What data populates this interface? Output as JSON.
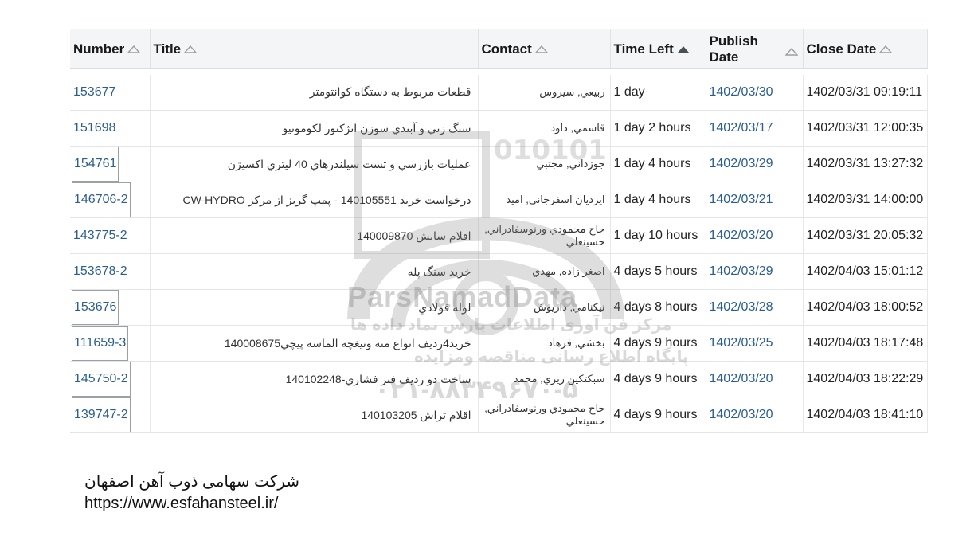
{
  "grid": {
    "columns": {
      "number": "Number",
      "title": "Title",
      "contact": "Contact",
      "time_left": "Time Left",
      "publish_line1": "Publish",
      "publish_line2": "Date",
      "close_date": "Close Date"
    },
    "rows": [
      {
        "number": "153677",
        "title": "قطعات مربوط به دستگاه کوانتومتر",
        "contact": "ربيعي, سيروس",
        "time_left": "1 day",
        "publish": "1402/03/30",
        "close": "1402/03/31 09:19:11"
      },
      {
        "number": "151698",
        "title": "سنگ زني و آبندي سوزن انژکتور لکوموتيو",
        "contact": "قاسمي, داود",
        "time_left": "1 day 2 hours",
        "publish": "1402/03/17",
        "close": "1402/03/31 12:00:35"
      },
      {
        "number": "154761",
        "title": "عمليات بازرسي و تست سيلندرهاي 40 ليتري اکسيژن",
        "contact": "جوزداني, مجتبي",
        "time_left": "1 day 4 hours",
        "publish": "1402/03/29",
        "close": "1402/03/31 13:27:32"
      },
      {
        "number": "146706-2",
        "title": "درخواست خريد 140105551 - پمپ گريز از مرکز CW-HYDRO",
        "contact": "ايزديان اسفرجاني, اميد",
        "time_left": "1 day 4 hours",
        "publish": "1402/03/21",
        "close": "1402/03/31 14:00:00"
      },
      {
        "number": "143775-2",
        "title": "اقلام سايش 140009870",
        "contact": "حاج محمودي ورنوسفادراني, حسينعلي",
        "time_left": "1 day 10 hours",
        "publish": "1402/03/20",
        "close": "1402/03/31 20:05:32"
      },
      {
        "number": "153678-2",
        "title": "خريد سنگ پله",
        "contact": "اصغر زاده, مهدي",
        "time_left": "4 days 5 hours",
        "publish": "1402/03/29",
        "close": "1402/04/03 15:01:12"
      },
      {
        "number": "153676",
        "title": "لوله فولادي",
        "contact": "نيکنامي, داريوش",
        "time_left": "4 days 8 hours",
        "publish": "1402/03/28",
        "close": "1402/04/03 18:00:52"
      },
      {
        "number": "111659-3",
        "title": "خريد4رديف انواع مته وتيغچه الماسه پيچي140008675",
        "contact": "بخشي, فرهاد",
        "time_left": "4 days 9 hours",
        "publish": "1402/03/25",
        "close": "1402/04/03 18:17:48"
      },
      {
        "number": "145750-2",
        "title": "ساخت دو رديف فنر فشاري-140102248",
        "contact": "سبکتکين ريزي, محمد",
        "time_left": "4 days 9 hours",
        "publish": "1402/03/20",
        "close": "1402/04/03 18:22:29"
      },
      {
        "number": "139747-2",
        "title": "اقلام تراش 140103205",
        "contact": "حاج محمودي ورنوسفادراني, حسينعلي",
        "time_left": "4 days 9 hours",
        "publish": "1402/03/20",
        "close": "1402/04/03 18:41:10"
      }
    ]
  },
  "watermark": {
    "brand": "ParsNamadData",
    "line1": "مرکز فن آوری اطلاعات پارس نماد داده ها",
    "line2": "پایگاه اطلاع رسانی مناقصه ومزایده",
    "phone": "۰۲۱-۸۸۳۴۹۶۷۰-۵",
    "logo_digits": "010101"
  },
  "caption": {
    "company": "شرکت سهامی ذوب آهن اصفهان",
    "url": "https://www.esfahansteel.ir/"
  },
  "colors": {
    "link": "#2a5d93",
    "header_bg": "#f4f5f7",
    "sort_icon": "#9aa0a6",
    "sort_icon_active": "#4a4f55"
  }
}
